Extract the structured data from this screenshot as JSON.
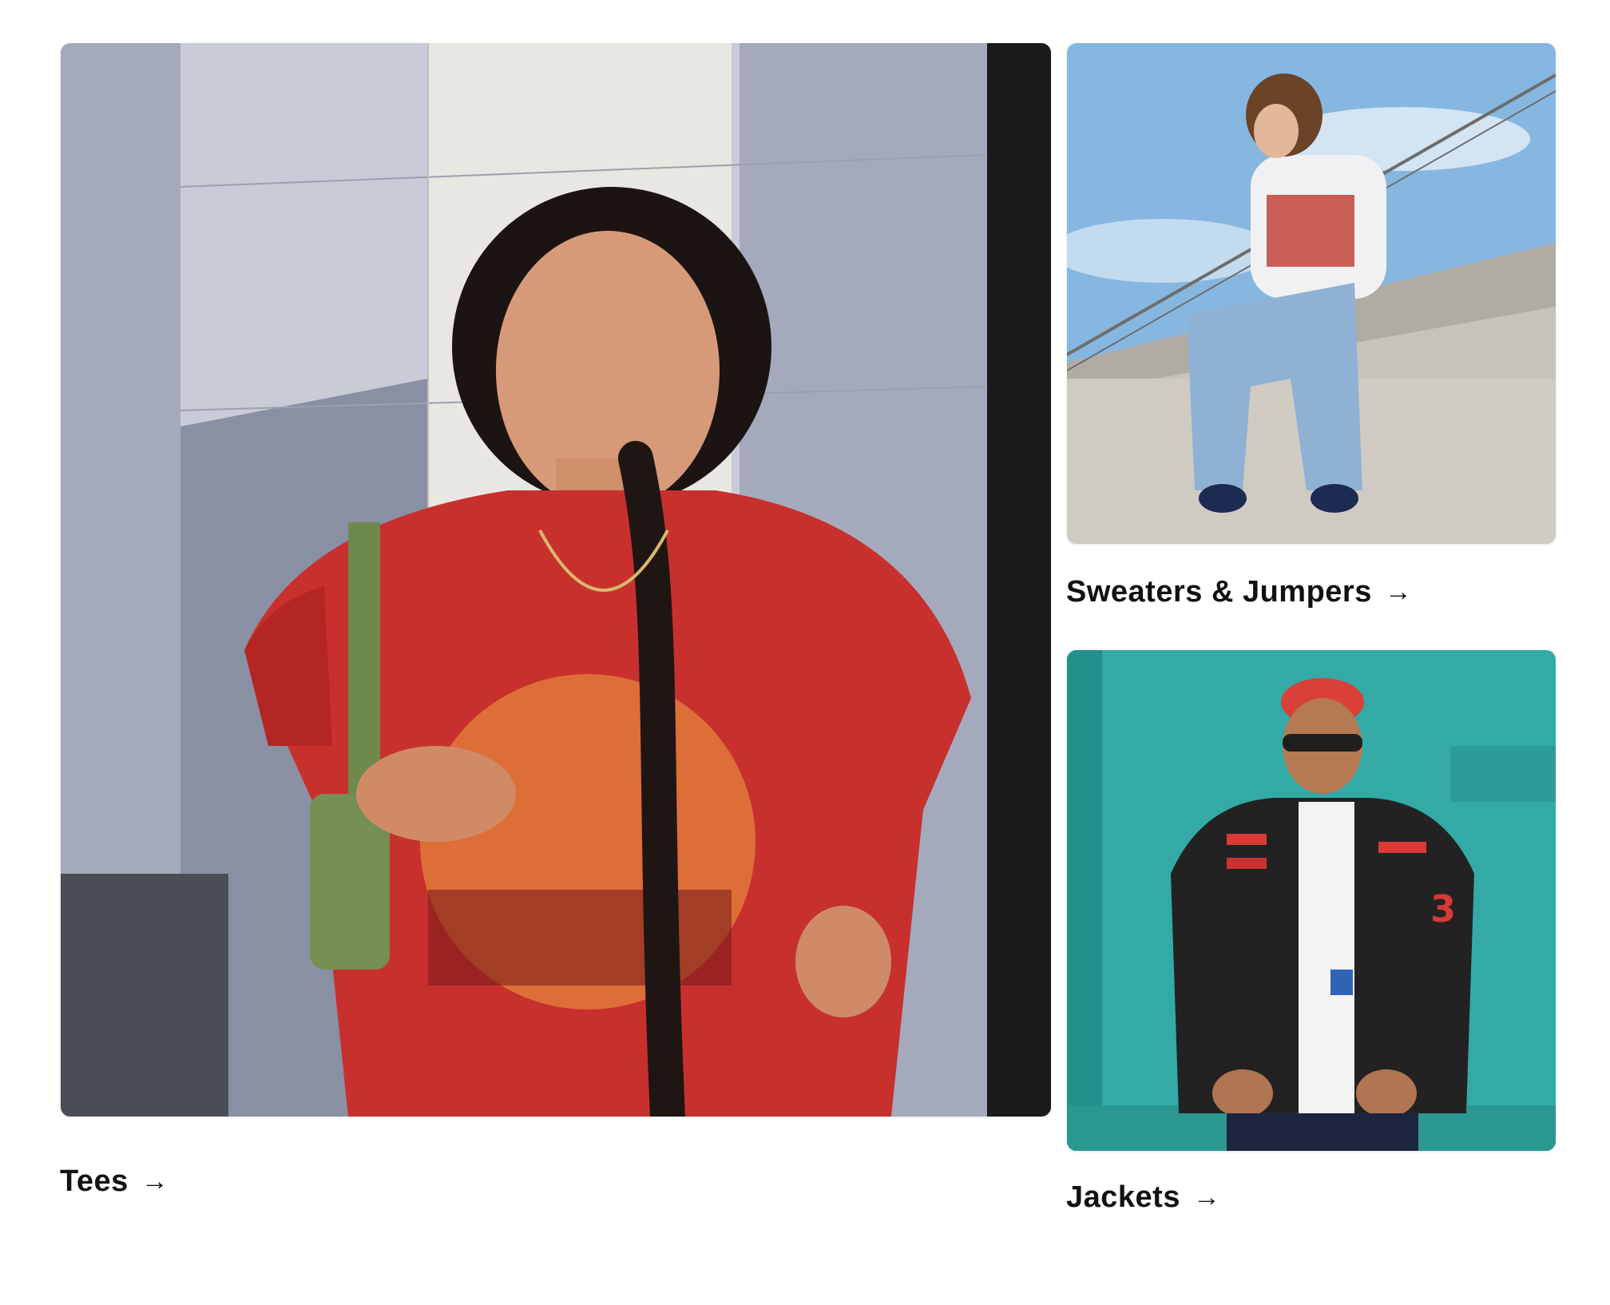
{
  "categories": [
    {
      "label": "Tees",
      "arrow": "→",
      "photo": "model-in-red-daytona-beach-tee"
    },
    {
      "label": "Sweaters & Jumpers",
      "arrow": "→",
      "photo": "model-in-white-racing-sweatshirt"
    },
    {
      "label": "Jackets",
      "arrow": "→",
      "photo": "model-in-black-racing-jacket"
    }
  ],
  "colors": {
    "text": "#111111",
    "tee_red": "#c8302e",
    "wall_grey": "#9ea4b4",
    "sky_blue": "#7fb2dd",
    "teal_wall": "#2fa7a3"
  }
}
